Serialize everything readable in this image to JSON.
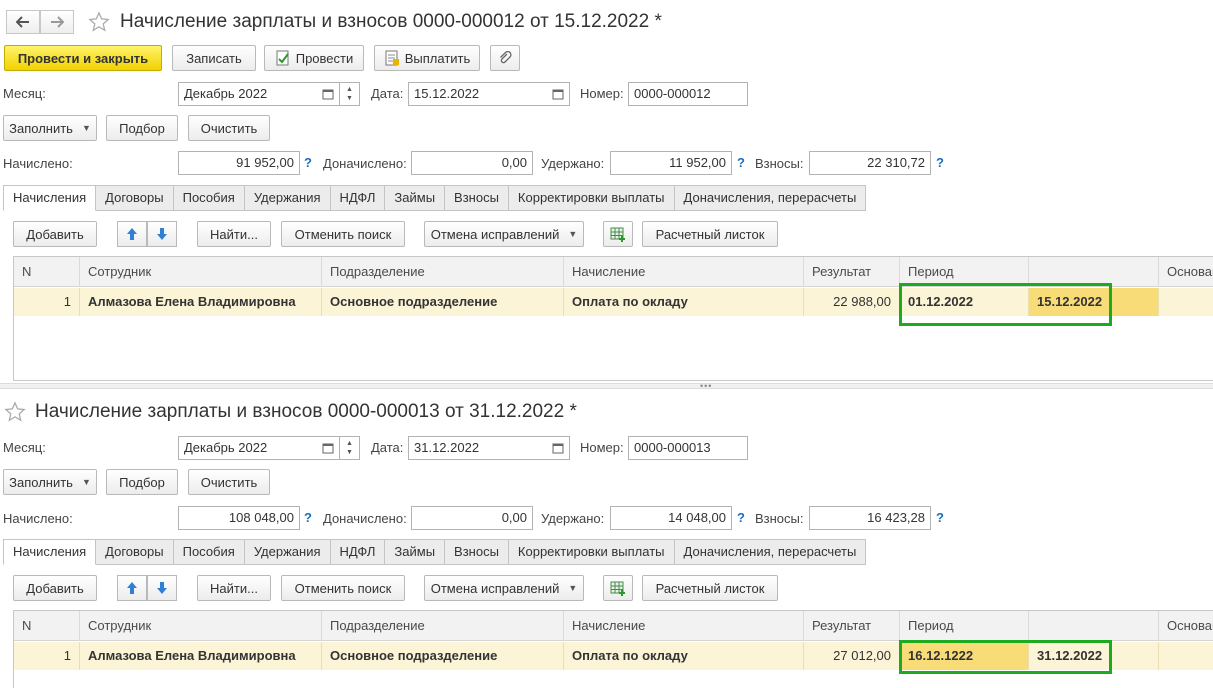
{
  "doc1": {
    "title": "Начисление зарплаты и взносов 0000-000012 от 15.12.2022 *",
    "toolbar": {
      "post_close": "Провести и закрыть",
      "save": "Записать",
      "post": "Провести",
      "pay": "Выплатить"
    },
    "month_label": "Месяц:",
    "month_value": "Декабрь 2022",
    "date_label": "Дата:",
    "date_value": "15.12.2022",
    "number_label": "Номер:",
    "number_value": "0000-000012",
    "fill_btn": "Заполнить",
    "pick_btn": "Подбор",
    "clear_btn": "Очистить",
    "accrued_label": "Начислено:",
    "accrued_value": "91 952,00",
    "extra_label": "Доначислено:",
    "extra_value": "0,00",
    "withheld_label": "Удержано:",
    "withheld_value": "11 952,00",
    "contrib_label": "Взносы:",
    "contrib_value": "22 310,72",
    "q": "?",
    "tabs": [
      "Начисления",
      "Договоры",
      "Пособия",
      "Удержания",
      "НДФЛ",
      "Займы",
      "Взносы",
      "Корректировки выплаты",
      "Доначисления, перерасчеты"
    ],
    "grid_toolbar": {
      "add": "Добавить",
      "find": "Найти...",
      "cancel_search": "Отменить поиск",
      "cancel_fix": "Отмена исправлений",
      "payslip": "Расчетный листок"
    },
    "columns": [
      "N",
      "Сотрудник",
      "Подразделение",
      "Начисление",
      "Результат",
      "Период",
      "",
      "Основание"
    ],
    "row": {
      "n": "1",
      "employee": "Алмазова Елена Владимировна",
      "department": "Основное подразделение",
      "accrual": "Оплата по окладу",
      "result": "22 988,00",
      "period_from": "01.12.2022",
      "period_to": "15.12.2022"
    }
  },
  "doc2": {
    "title": "Начисление зарплаты и взносов 0000-000013 от 31.12.2022 *",
    "month_label": "Месяц:",
    "month_value": "Декабрь 2022",
    "date_label": "Дата:",
    "date_value": "31.12.2022",
    "number_label": "Номер:",
    "number_value": "0000-000013",
    "fill_btn": "Заполнить",
    "pick_btn": "Подбор",
    "clear_btn": "Очистить",
    "accrued_label": "Начислено:",
    "accrued_value": "108 048,00",
    "extra_label": "Доначислено:",
    "extra_value": "0,00",
    "withheld_label": "Удержано:",
    "withheld_value": "14 048,00",
    "contrib_label": "Взносы:",
    "contrib_value": "16 423,28",
    "q": "?",
    "tabs": [
      "Начисления",
      "Договоры",
      "Пособия",
      "Удержания",
      "НДФЛ",
      "Займы",
      "Взносы",
      "Корректировки выплаты",
      "Доначисления, перерасчеты"
    ],
    "grid_toolbar": {
      "add": "Добавить",
      "find": "Найти...",
      "cancel_search": "Отменить поиск",
      "cancel_fix": "Отмена исправлений",
      "payslip": "Расчетный листок"
    },
    "columns": [
      "N",
      "Сотрудник",
      "Подразделение",
      "Начисление",
      "Результат",
      "Период",
      "",
      "Основание"
    ],
    "row": {
      "n": "1",
      "employee": "Алмазова Елена Владимировна",
      "department": "Основное подразделение",
      "accrual": "Оплата по окладу",
      "result": "27 012,00",
      "period_from": "16.12.1222",
      "period_to": "31.12.2022"
    }
  },
  "colors": {
    "highlight": "#1eaa1e",
    "accent_button": "#f1d200",
    "row_bg": "#fbf4d6"
  }
}
